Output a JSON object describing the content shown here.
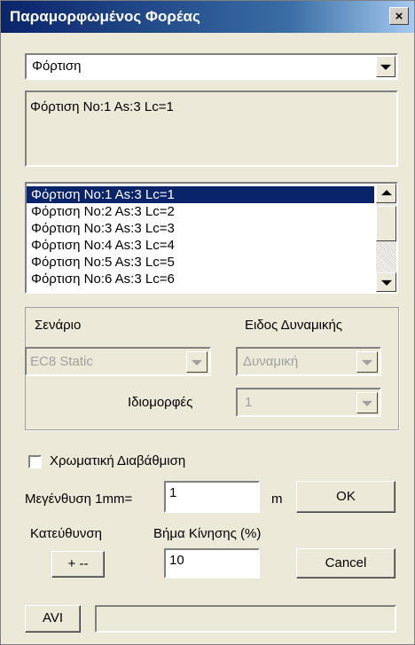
{
  "window": {
    "title": "Παραμορφωμένος Φορέας",
    "close_label": "×"
  },
  "loading_select": {
    "value": "Φόρτιση"
  },
  "info_box": {
    "text": "Φόρτιση No:1 As:3 Lc=1"
  },
  "load_list": {
    "items": [
      "Φόρτιση No:1 As:3 Lc=1",
      "Φόρτιση No:2 As:3 Lc=2",
      "Φόρτιση No:3 As:3 Lc=3",
      "Φόρτιση No:4 As:3 Lc=4",
      "Φόρτιση No:5 As:3 Lc=5",
      "Φόρτιση No:6 As:3 Lc=6"
    ],
    "selected_index": 0
  },
  "scenario": {
    "scenario_label": "Σενάριο",
    "dynamic_type_label": "Ειδος Δυναμικής",
    "scenario_value": "EC8 Static",
    "dynamic_type_value": "Δυναμική",
    "mode_shapes_label": "Ιδιομορφές",
    "mode_shapes_value": "1"
  },
  "color_gradation": {
    "label": "Χρωματική Διαβάθμιση",
    "checked": false
  },
  "magnification": {
    "label": "Μεγένθυση 1mm=",
    "value": "1",
    "unit": "m"
  },
  "ok_button": {
    "label": "OK"
  },
  "direction": {
    "label": "Κατεύθυνση",
    "button_label": "+ --"
  },
  "step": {
    "label": "Βήμα Κίνησης (%)",
    "value": "10"
  },
  "cancel_button": {
    "label": "Cancel"
  },
  "avi_button": {
    "label": "AVI"
  },
  "status_field": {
    "value": ""
  }
}
